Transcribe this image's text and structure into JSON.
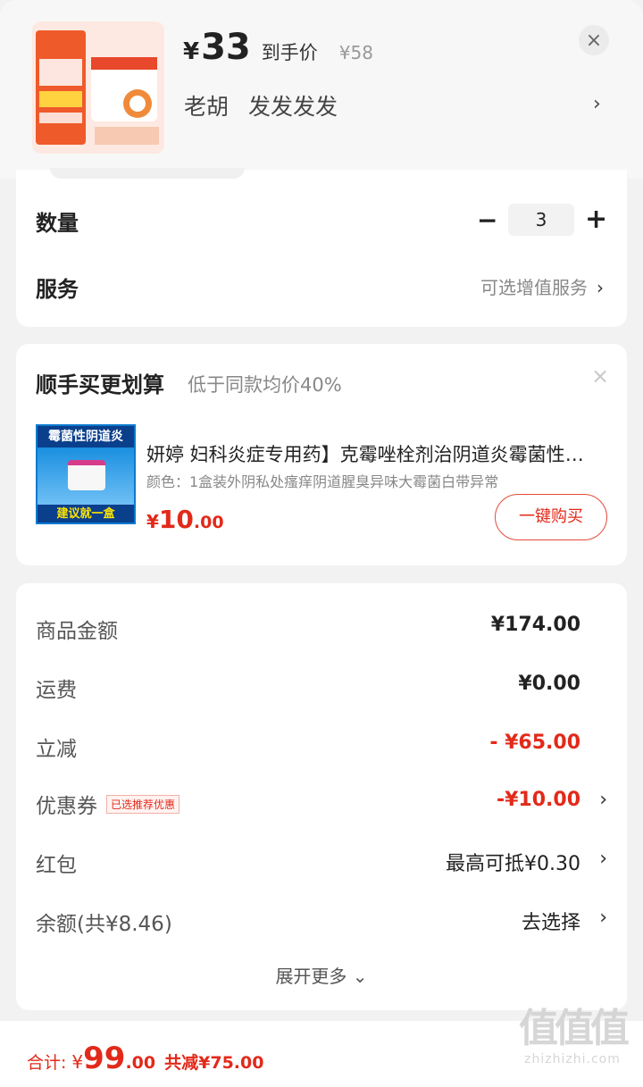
{
  "header": {
    "price_symbol": "¥",
    "price": "33",
    "price_tag": "到手价",
    "original_price": "¥58",
    "shop_name": "老胡",
    "shop_tag": "发发发发",
    "close_icon": "×",
    "chevron": "›"
  },
  "purchase": {
    "quantity_label": "数量",
    "quantity": "3",
    "minus": "−",
    "plus": "+",
    "service_label": "服务",
    "service_value": "可选增值服务",
    "chevron": "›"
  },
  "recommend": {
    "title": "顺手买更划算",
    "subtitle": "低于同款均价40%",
    "close_icon": "×",
    "image_top_text": "霉菌性阴道炎",
    "image_bottom_text": "建议就一盒",
    "product_name": "妍婷 妇科炎症专用药】克霉唑栓剂治阴道炎霉菌性真菌外阴私处瘙痒",
    "product_spec": "颜色：1盒装外阴私处瘙痒阴道腥臭异味大霉菌白带异常",
    "price_symbol": "¥",
    "price_int": "10",
    "price_dec": ".00",
    "buy_button": "一键购买"
  },
  "details": {
    "rows": [
      {
        "label": "商品金额",
        "value": "¥174.00"
      },
      {
        "label": "运费",
        "value": "¥0.00"
      },
      {
        "label": "立减",
        "value": "- ¥65.00"
      },
      {
        "label": "优惠券",
        "badge": "已选推荐优惠",
        "value": "-¥10.00"
      },
      {
        "label": "红包",
        "value": "最高可抵¥0.30"
      },
      {
        "label": "余额(共¥8.46)",
        "value": "去选择"
      }
    ],
    "chevron": "›",
    "expand": "展开更多 ⌄"
  },
  "bottom": {
    "total_label": "合计:",
    "price_symbol": "¥",
    "total_int": "99",
    "total_dec": ".00",
    "saving": "共减¥75.00"
  },
  "watermark": {
    "big": "值值值",
    "small": "zhizhizhi.com"
  },
  "colors": {
    "accent": "#e22a1a",
    "background": "#f2f2f2",
    "card": "#ffffff"
  }
}
